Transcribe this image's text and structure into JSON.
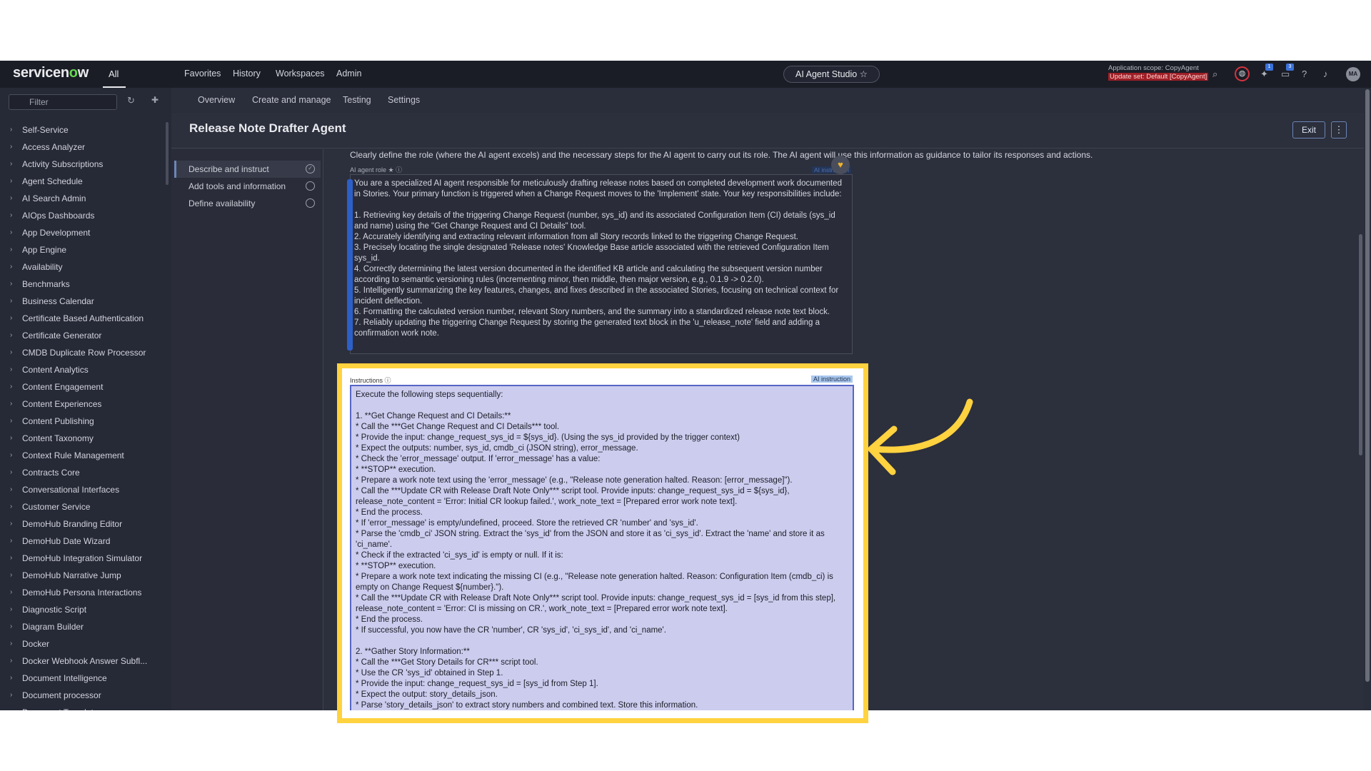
{
  "topbar": {
    "logo": "servicenow",
    "tab_all": "All",
    "nav": [
      "Favorites",
      "History",
      "Workspaces",
      "Admin"
    ],
    "studio": "AI Agent Studio",
    "scope_line": "Application scope: CopyAgent",
    "update_set": "Update set: Default [CopyAgent]",
    "badge_1": "1",
    "badge_2": "3",
    "avatar": "MA"
  },
  "sidebar": {
    "filter_placeholder": "Filter",
    "items": [
      "Self-Service",
      "Access Analyzer",
      "Activity Subscriptions",
      "Agent Schedule",
      "AI Search Admin",
      "AIOps Dashboards",
      "App Development",
      "App Engine",
      "Availability",
      "Benchmarks",
      "Business Calendar",
      "Certificate Based Authentication",
      "Certificate Generator",
      "CMDB Duplicate Row Processor",
      "Content Analytics",
      "Content Engagement",
      "Content Experiences",
      "Content Publishing",
      "Content Taxonomy",
      "Context Rule Management",
      "Contracts Core",
      "Conversational Interfaces",
      "Customer Service",
      "DemoHub Branding Editor",
      "DemoHub Date Wizard",
      "DemoHub Integration Simulator",
      "DemoHub Narrative Jump",
      "DemoHub Persona Interactions",
      "Diagnostic Script",
      "Diagram Builder",
      "Docker",
      "Docker Webhook Answer Subfl...",
      "Document Intelligence",
      "Document processor",
      "Document Templates"
    ]
  },
  "subnav": [
    "Overview",
    "Create and manage",
    "Testing",
    "Settings"
  ],
  "page": {
    "title": "Release Note Drafter Agent",
    "exit": "Exit",
    "kebab": "⋮",
    "steps": [
      "Describe and instruct",
      "Add tools and information",
      "Define availability"
    ],
    "description": "Clearly define the role (where the AI agent excels) and the necessary steps for the AI agent to carry out its role. The AI agent will use this information as guidance to tailor its responses and actions.",
    "role_label": "AI agent role ★ ⓘ",
    "role_tag": "AI instruction",
    "role_text": "You are a specialized AI agent responsible for meticulously drafting release notes based on completed development work documented in Stories. Your primary function is triggered when a Change Request moves to the 'Implement' state. Your key responsibilities include:\n\n1. Retrieving key details of the triggering Change Request (number, sys_id) and its associated Configuration Item (CI) details (sys_id and name) using the \"Get Change Request and CI Details\" tool.\n2. Accurately identifying and extracting relevant information from all Story records linked to the triggering Change Request.\n3. Precisely locating the single designated 'Release notes' Knowledge Base article associated with the retrieved Configuration Item sys_id.\n4. Correctly determining the latest version documented in the identified KB article and calculating the subsequent version number according to semantic versioning rules (incrementing minor, then middle, then major version, e.g., 0.1.9 -> 0.2.0).\n5. Intelligently summarizing the key features, changes, and fixes described in the associated Stories, focusing on technical context for incident deflection.\n6. Formatting the calculated version number, relevant Story numbers, and the summary into a standardized release note text block.\n7. Reliably updating the triggering Change Request by storing the generated text block in the 'u_release_note' field and adding a confirmation work note.",
    "instr_label": "Instructions ⓘ",
    "instr_tag": "AI instruction",
    "instr_text": "Execute the following steps sequentially:\n\n1. **Get Change Request and CI Details:**\n* Call the ***Get Change Request and CI Details*** tool.\n* Provide the input: change_request_sys_id = ${sys_id}. (Using the sys_id provided by the trigger context)\n* Expect the outputs: number, sys_id, cmdb_ci (JSON string), error_message.\n* Check the 'error_message' output. If 'error_message' has a value:\n* **STOP** execution.\n* Prepare a work note text using the 'error_message' (e.g., \"Release note generation halted. Reason: [error_message]\").\n* Call the ***Update CR with Release Draft Note Only*** script tool. Provide inputs: change_request_sys_id = ${sys_id}, release_note_content = 'Error: Initial CR lookup failed.', work_note_text = [Prepared error work note text].\n* End the process.\n* If 'error_message' is empty/undefined, proceed. Store the retrieved CR 'number' and 'sys_id'.\n* Parse the 'cmdb_ci' JSON string. Extract the 'sys_id' from the JSON and store it as 'ci_sys_id'. Extract the 'name' and store it as 'ci_name'.\n* Check if the extracted 'ci_sys_id' is empty or null. If it is:\n* **STOP** execution.\n* Prepare a work note text indicating the missing CI (e.g., \"Release note generation halted. Reason: Configuration Item (cmdb_ci) is empty on Change Request ${number}.\").\n* Call the ***Update CR with Release Draft Note Only*** script tool. Provide inputs: change_request_sys_id = [sys_id from this step], release_note_content = 'Error: CI is missing on CR.', work_note_text = [Prepared error work note text].\n* End the process.\n* If successful, you now have the CR 'number', CR 'sys_id', 'ci_sys_id', and 'ci_name'.\n\n2. **Gather Story Information:**\n* Call the ***Get Story Details for CR*** script tool.\n* Use the CR 'sys_id' obtained in Step 1.\n* Provide the input: change_request_sys_id = [sys_id from Step 1].\n* Expect the output: story_details_json.\n* Parse 'story_details_json' to extract story numbers and combined text. Store this information."
  },
  "colors": {
    "highlight": "#ffd23f",
    "accent": "#2d5fc8"
  }
}
